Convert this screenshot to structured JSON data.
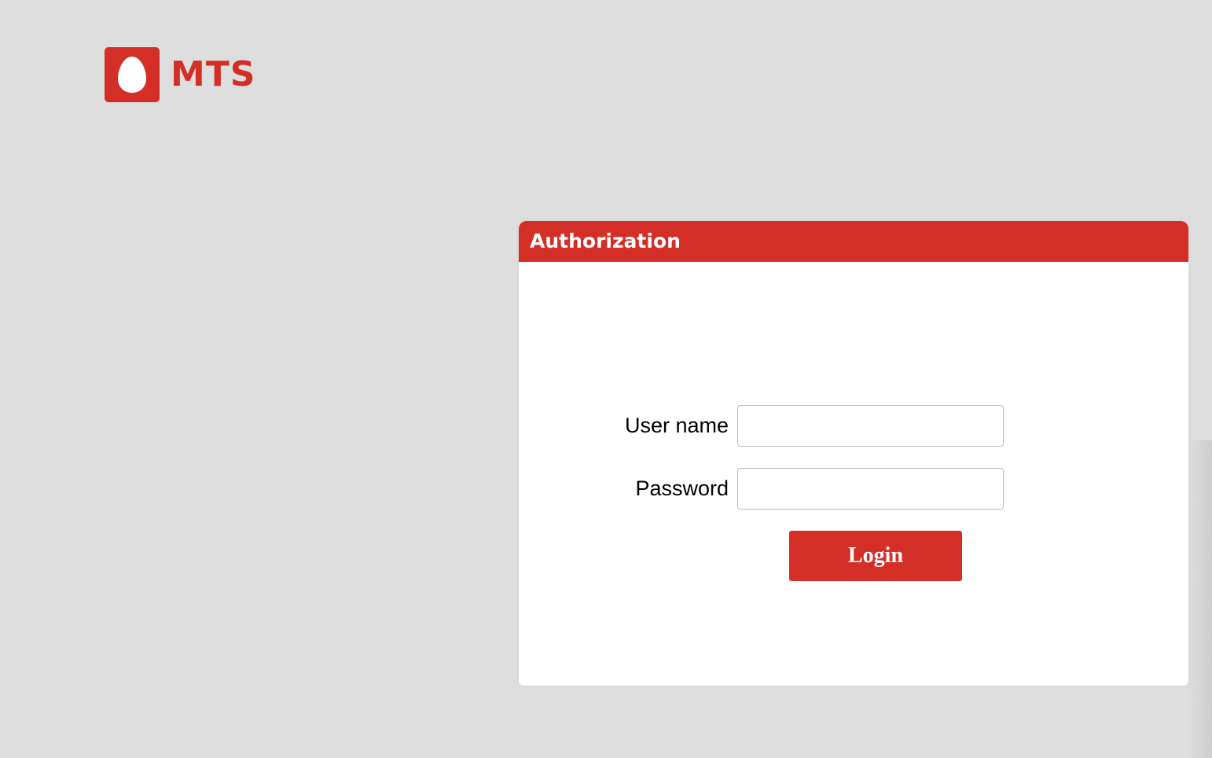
{
  "logo": {
    "text": "MTS",
    "icon": "egg-icon",
    "brand_color": "#d32f27"
  },
  "auth_panel": {
    "title": "Authorization",
    "username_label": "User name",
    "username_value": "",
    "password_label": "Password",
    "password_value": "",
    "login_label": "Login"
  },
  "colors": {
    "accent": "#d32f27",
    "background": "#dedede",
    "panel": "#ffffff"
  }
}
